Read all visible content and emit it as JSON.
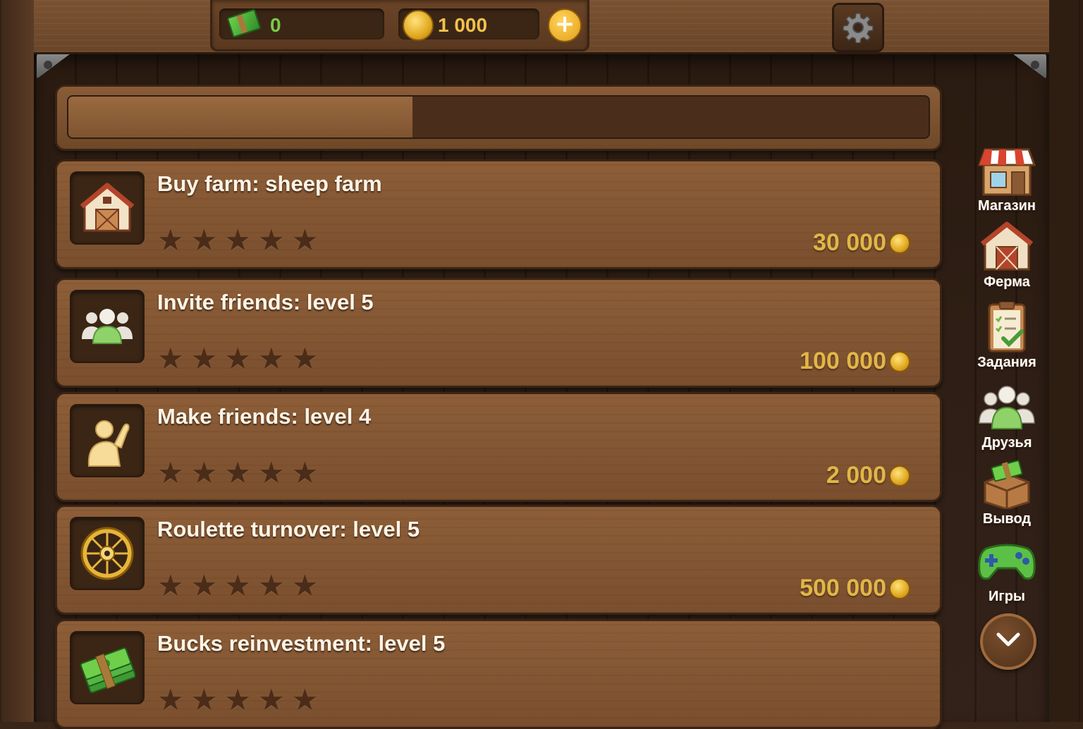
{
  "currency": {
    "bucks": "0",
    "coins": "1 000",
    "add_label": "+"
  },
  "progress": {
    "fraction": 0.4
  },
  "quests": [
    {
      "title": "Buy farm: sheep farm",
      "icon": "barn-icon",
      "stars_filled": 0,
      "stars_total": 5,
      "reward": "30 000"
    },
    {
      "title": "Invite friends: level 5",
      "icon": "friends-icon",
      "stars_filled": 0,
      "stars_total": 5,
      "reward": "100 000"
    },
    {
      "title": "Make friends: level 4",
      "icon": "waving-person-icon",
      "stars_filled": 0,
      "stars_total": 5,
      "reward": "2 000"
    },
    {
      "title": "Roulette turnover: level 5",
      "icon": "roulette-icon",
      "stars_filled": 0,
      "stars_total": 5,
      "reward": "500 000"
    },
    {
      "title": "Bucks reinvestment: level 5",
      "icon": "cash-stack-icon",
      "stars_filled": 0,
      "stars_total": 5,
      "reward": ""
    }
  ],
  "side_nav": [
    {
      "label": "Магазин",
      "icon": "shop-icon"
    },
    {
      "label": "Ферма",
      "icon": "barn-icon"
    },
    {
      "label": "Задания",
      "icon": "clipboard-icon"
    },
    {
      "label": "Друзья",
      "icon": "friends-icon"
    },
    {
      "label": "Вывод",
      "icon": "withdraw-box-icon"
    },
    {
      "label": "Игры",
      "icon": "gamepad-icon"
    }
  ],
  "colors": {
    "title_text": "#fff4e6",
    "reward_text": "#e2b646",
    "bucks_text": "#7bc94a",
    "coins_text": "#f2c14b",
    "star_empty": "#4a2c18"
  }
}
